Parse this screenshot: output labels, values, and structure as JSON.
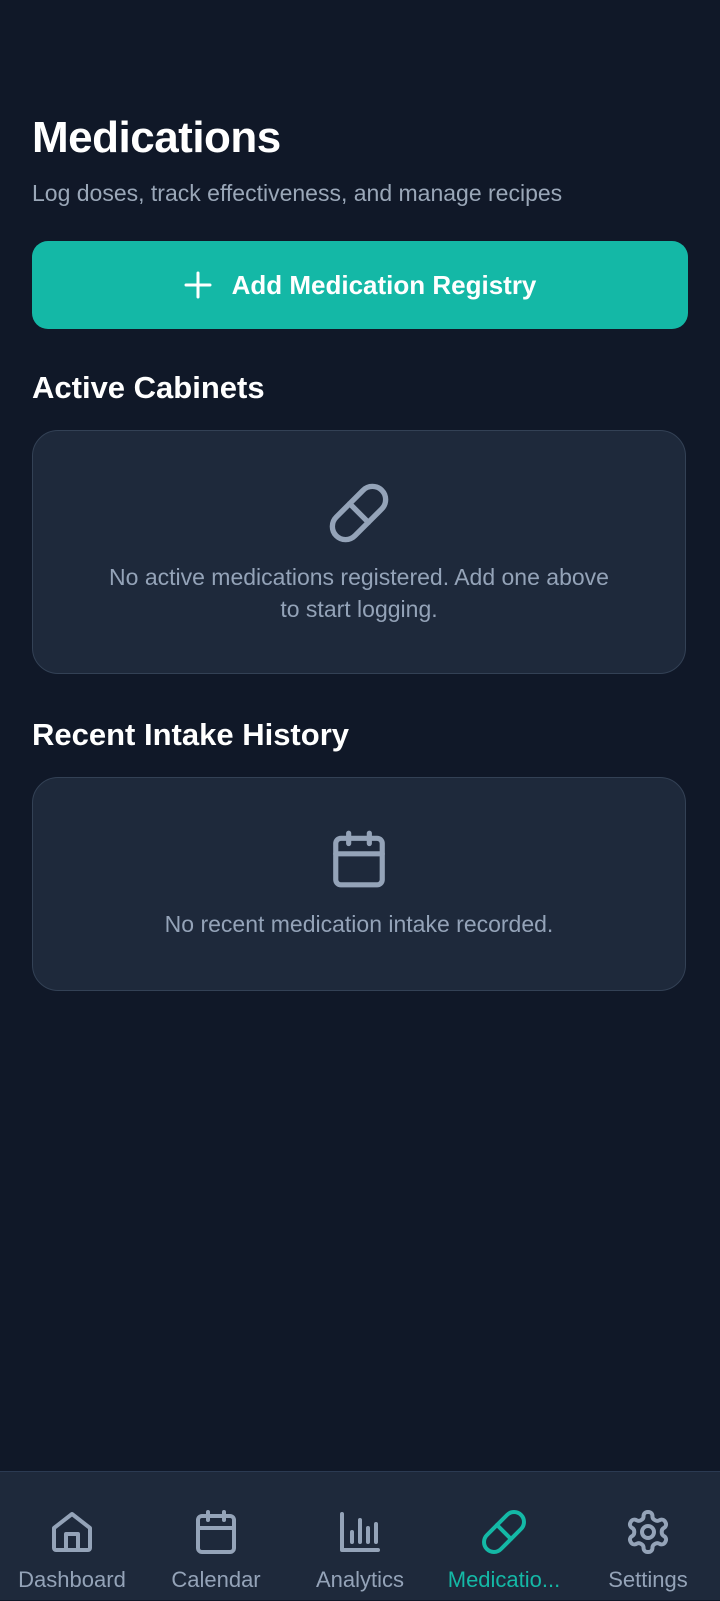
{
  "header": {
    "title": "Medications",
    "subtitle": "Log doses, track effectiveness, and manage recipes"
  },
  "actions": {
    "add_label": "Add Medication Registry",
    "add_icon": "plus-icon"
  },
  "sections": {
    "cabinets": {
      "title": "Active Cabinets",
      "empty_icon": "pill-icon",
      "empty_message": "No active medications registered. Add one above to start logging."
    },
    "history": {
      "title": "Recent Intake History",
      "empty_icon": "calendar-icon",
      "empty_message": "No recent medication intake recorded."
    }
  },
  "nav": {
    "items": [
      {
        "label": "Dashboard",
        "icon": "home-icon",
        "active": false
      },
      {
        "label": "Calendar",
        "icon": "calendar-icon",
        "active": false
      },
      {
        "label": "Analytics",
        "icon": "bar-chart-icon",
        "active": false
      },
      {
        "label": "Medicatio...",
        "icon": "pill-icon",
        "active": true
      },
      {
        "label": "Settings",
        "icon": "gear-icon",
        "active": false
      }
    ]
  },
  "colors": {
    "background": "#101828",
    "card": "#1e293b",
    "accent": "#14b8a6",
    "muted_text": "#94a3b8"
  }
}
